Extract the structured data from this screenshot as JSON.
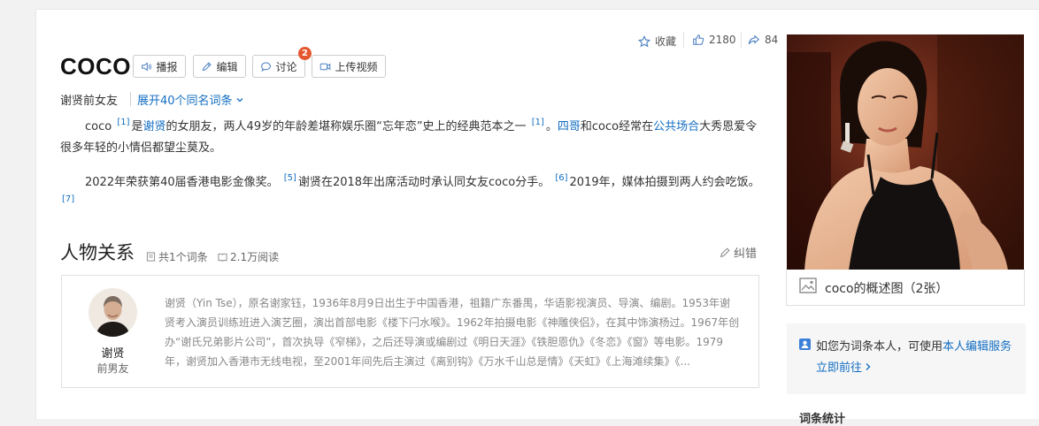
{
  "header": {
    "favorite_label": "收藏",
    "likes": "2180",
    "shares": "84"
  },
  "entry": {
    "title": "COCO",
    "subtitle": "谢贤前女友",
    "synonyms_link": "展开40个同名词条",
    "buttons": {
      "broadcast": "播报",
      "edit": "编辑",
      "discuss": "讨论",
      "discuss_badge": "2",
      "upload_video": "上传视频"
    }
  },
  "summary": {
    "p1": {
      "t1": "coco ",
      "sup1": "[1]",
      "t2": "是",
      "link1": "谢贤",
      "t3": "的女朋友，两人49岁的年龄差堪称娱乐圈“忘年恋”史上的经典范本之一 ",
      "sup2": "[1]",
      "t4": "。",
      "link2": "四哥",
      "t5": "和coco经常在",
      "link3": "公共场合",
      "t6": "大秀恩爱令很多年轻的小情侣都望尘莫及。"
    },
    "p2": {
      "t1": "2022年荣获第40届香港电影金像奖。 ",
      "sup1": "[5]",
      "t2": "谢贤在2018年出席活动时承认同女友coco分手。 ",
      "sup2": "[6]",
      "t3": "2019年，媒体拍摄到两人约会吃饭。 ",
      "sup3": "[7]"
    }
  },
  "relations": {
    "title": "人物关系",
    "entry_count": "共1个词条",
    "read_count": "2.1万阅读",
    "errata": "纠错",
    "person": {
      "name": "谢贤",
      "relation": "前男友",
      "bio": "谢贤（Yin Tse），原名谢家钰，1936年8月9日出生于中国香港，祖籍广东番禺，华语影视演员、导演、编剧。1953年谢贤考入演员训练班进入演艺圈，演出首部电影《楼下闩水喉》。1962年拍摄电影《神雕侠侣》，在其中饰演杨过。1967年创办“谢氏兄弟影片公司”，首次执导《窄梯》，之后还导演或编剧过《明日天涯》《铁胆恩仇》《冬恋》《窗》等电影。1979年，谢贤加入香港市无线电视，至2001年间先后主演过《离别钩》《万水千山总是情》《天虹》《上海滩续集》《..."
    }
  },
  "sidebar": {
    "photo_caption": "coco的概述图（2张）",
    "claim_text_prefix": "如您为词条本人，可使用",
    "claim_link": "本人编辑服务",
    "claim_go": "立即前往",
    "stats_title": "词条统计"
  },
  "colors": {
    "link": "#136ec2",
    "badge": "#e4572e"
  }
}
